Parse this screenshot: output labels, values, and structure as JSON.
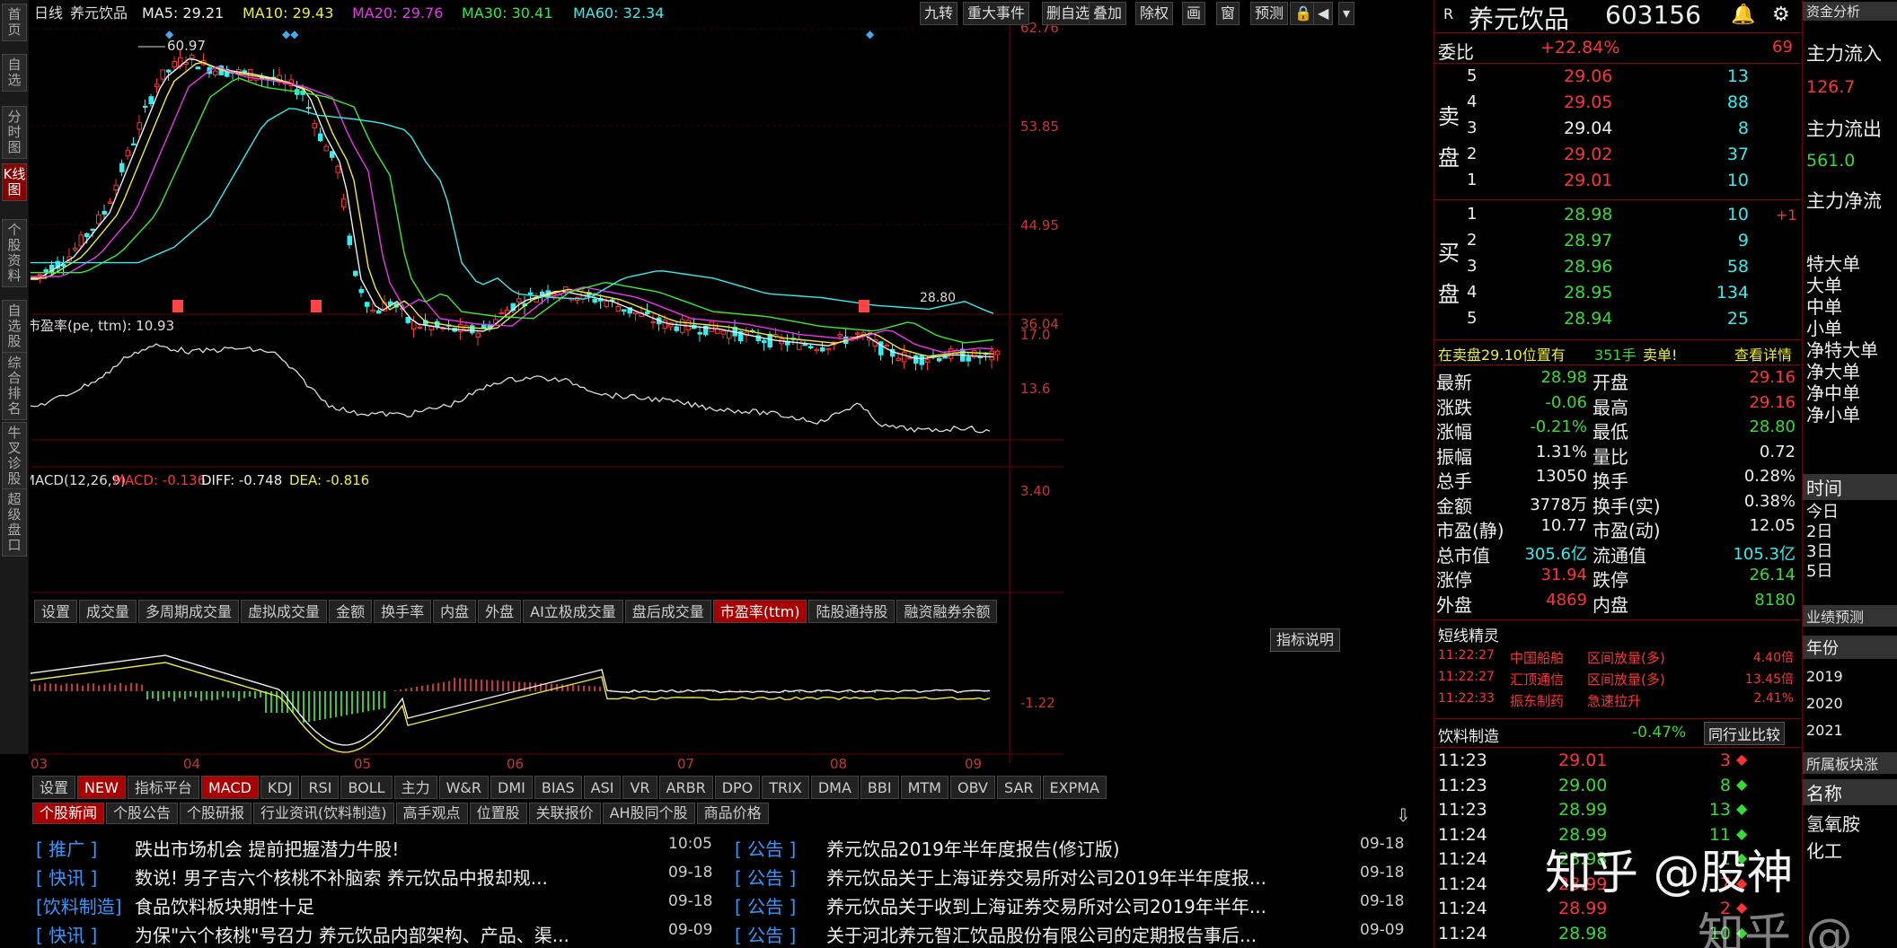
{
  "left_tabs": [
    "首页",
    "自选",
    "分时图",
    "K线图",
    "个股资料",
    "自选股",
    "综合排名",
    "牛叉诊股",
    "超级盘口"
  ],
  "chart_header": {
    "period": "日线",
    "stock": "养元饮品",
    "ma5": "MA5: 29.21",
    "ma10": "MA10: 29.43",
    "ma20": "MA20: 29.76",
    "ma30": "MA30: 30.41",
    "ma60": "MA60: 32.34"
  },
  "toolbar": [
    "九转",
    "重大事件",
    "删自选",
    "叠加",
    "除权",
    "画",
    "窗",
    "预测"
  ],
  "price_axis": [
    "62.76",
    "53.85",
    "44.95",
    "36.04"
  ],
  "high_label": "60.97",
  "low_label": "28.80",
  "pe_header": "市盈率(pe, ttm): 10.93",
  "pe_axis": [
    "17.0",
    "13.6"
  ],
  "indicator_tabs1": [
    "设置",
    "成交量",
    "多周期成交量",
    "虚拟成交量",
    "金额",
    "换手率",
    "内盘",
    "外盘",
    "AI立极成交量",
    "盘后成交量",
    "市盈率(ttm)",
    "陆股通持股",
    "融资融券余额"
  ],
  "indicator_tabs1_active": 10,
  "macd_header": {
    "name": "MACD(12,26,9)",
    "macd": "MACD: -0.136",
    "diff": "DIFF: -0.748",
    "dea": "DEA: -0.816"
  },
  "macd_button": "指标说明",
  "macd_axis": [
    "3.40",
    "-1.22"
  ],
  "months": [
    "03",
    "04",
    "05",
    "06",
    "07",
    "08",
    "09"
  ],
  "indicator_tabs2": [
    "设置",
    "NEW",
    "指标平台",
    "MACD",
    "KDJ",
    "RSI",
    "BOLL",
    "主力",
    "W&R",
    "DMI",
    "BIAS",
    "ASI",
    "VR",
    "ARBR",
    "DPO",
    "TRIX",
    "DMA",
    "BBI",
    "MTM",
    "OBV",
    "SAR",
    "EXPMA"
  ],
  "indicator_tabs2_active": 3,
  "news_tabs": [
    "个股新闻",
    "个股公告",
    "个股研报",
    "行业资讯(饮料制造)",
    "高手观点",
    "位置股",
    "关联报价",
    "AH股同个股",
    "商品价格"
  ],
  "news_left": [
    {
      "tag": "[ 推广 ]",
      "title": "跌出市场机会 提前把握潜力牛股!",
      "time": "10:05"
    },
    {
      "tag": "[ 快讯 ]",
      "title": "数说! 男子吉六个核桃不补脑索 养元饮品中报却规...",
      "time": "09-18"
    },
    {
      "tag": "[饮料制造]",
      "title": "食品饮料板块期性十足",
      "time": "09-18"
    },
    {
      "tag": "[ 快讯 ]",
      "title": "为保\"六个核桃\"号召力 养元饮品内部架构、产品、渠...",
      "time": "09-09"
    }
  ],
  "news_right": [
    {
      "tag": "[ 公告 ]",
      "title": "养元饮品2019年半年度报告(修订版)",
      "time": "09-18"
    },
    {
      "tag": "[ 公告 ]",
      "title": "养元饮品关于上海证券交易所对公司2019年半年度报...",
      "time": "09-18"
    },
    {
      "tag": "[ 公告 ]",
      "title": "养元饮品关于收到上海证券交易所对公司2019年半年...",
      "time": "09-18"
    },
    {
      "tag": "[ 公告 ]",
      "title": "关于河北养元智汇饮品股份有限公司的定期报告事后...",
      "time": "09-09"
    }
  ],
  "quote": {
    "name": "养元饮品",
    "code": "603156",
    "weibi_label": "委比",
    "weibi": "+22.84%",
    "weibi_right": "69",
    "sell_label": [
      "卖",
      "盘"
    ],
    "buy_label": [
      "买",
      "盘"
    ],
    "sell": [
      {
        "n": "5",
        "p": "29.06",
        "v": "13"
      },
      {
        "n": "4",
        "p": "29.05",
        "v": "88"
      },
      {
        "n": "3",
        "p": "29.04",
        "v": "8"
      },
      {
        "n": "2",
        "p": "29.02",
        "v": "37"
      },
      {
        "n": "1",
        "p": "29.01",
        "v": "10"
      }
    ],
    "buy": [
      {
        "n": "1",
        "p": "28.98",
        "v": "10"
      },
      {
        "n": "2",
        "p": "28.97",
        "v": "9"
      },
      {
        "n": "3",
        "p": "28.96",
        "v": "58"
      },
      {
        "n": "4",
        "p": "28.95",
        "v": "134"
      },
      {
        "n": "5",
        "p": "28.94",
        "v": "25"
      }
    ],
    "buy1_right": "+1",
    "pending_info": "在卖盘29.10位置有",
    "pending_vol": "351手",
    "pending_btn": "卖单!",
    "pending_detail": "查看详情",
    "stats": [
      {
        "l1": "最新",
        "v1": "28.98",
        "c1": "green",
        "l2": "开盘",
        "v2": "29.16",
        "c2": "red"
      },
      {
        "l1": "涨跌",
        "v1": "-0.06",
        "c1": "green",
        "l2": "最高",
        "v2": "29.16",
        "c2": "red"
      },
      {
        "l1": "涨幅",
        "v1": "-0.21%",
        "c1": "green",
        "l2": "最低",
        "v2": "28.80",
        "c2": "green"
      },
      {
        "l1": "振幅",
        "v1": "1.31%",
        "c1": "white",
        "l2": "量比",
        "v2": "0.72",
        "c2": "white"
      },
      {
        "l1": "总手",
        "v1": "13050",
        "c1": "white",
        "l2": "换手",
        "v2": "0.28%",
        "c2": "white"
      },
      {
        "l1": "金额",
        "v1": "3778万",
        "c1": "white",
        "l2": "换手(实)",
        "v2": "0.38%",
        "c2": "white"
      },
      {
        "l1": "市盈(静)",
        "v1": "10.77",
        "c1": "white",
        "l2": "市盈(动)",
        "v2": "12.05",
        "c2": "white"
      },
      {
        "l1": "总市值",
        "v1": "305.6亿",
        "c1": "cyan",
        "l2": "流通值",
        "v2": "105.3亿",
        "c2": "cyan"
      },
      {
        "l1": "涨停",
        "v1": "31.94",
        "c1": "red",
        "l2": "跌停",
        "v2": "26.14",
        "c2": "green"
      },
      {
        "l1": "外盘",
        "v1": "4869",
        "c1": "red",
        "l2": "内盘",
        "v2": "8180",
        "c2": "green"
      }
    ],
    "elves_title": "短线精灵",
    "elves": [
      {
        "t": "11:22:27",
        "s": "中国船舶",
        "e": "区间放量(多)",
        "v": "4.40倍"
      },
      {
        "t": "11:22:27",
        "s": "汇顶通信",
        "e": "区间放量(多)",
        "v": "13.45倍"
      },
      {
        "t": "11:22:33",
        "s": "振东制药",
        "e": "急速拉升",
        "v": "2.41%"
      }
    ],
    "industry": "饮料制造",
    "industry_pct": "-0.47%",
    "industry_btn": "同行业比较",
    "ticks": [
      {
        "t": "11:23",
        "p": "29.01",
        "v": "3",
        "d": "up"
      },
      {
        "t": "11:23",
        "p": "29.00",
        "v": "8",
        "d": "down"
      },
      {
        "t": "11:23",
        "p": "28.99",
        "v": "13",
        "d": "down"
      },
      {
        "t": "11:24",
        "p": "28.99",
        "v": "11",
        "d": "down"
      },
      {
        "t": "11:24",
        "p": "28.98",
        "v": "1",
        "d": "down"
      },
      {
        "t": "11:24",
        "p": "28.99",
        "v": "7",
        "d": "up"
      },
      {
        "t": "11:24",
        "p": "28.99",
        "v": "2",
        "d": "up"
      },
      {
        "t": "11:24",
        "p": "28.98",
        "v": "10",
        "d": "down"
      }
    ]
  },
  "far_right": {
    "title": "资金分析",
    "l1": "主力流入",
    "v1": "126.7",
    "l2": "主力流出",
    "v2": "561.0",
    "l3": "主力净流",
    "list": [
      "特大单",
      "大单",
      "中单",
      "小单",
      "净特大单",
      "净大单",
      "净中单",
      "净小单"
    ],
    "time_label": "时间",
    "days": [
      "今日",
      "2日",
      "3日",
      "5日"
    ],
    "perf": "业绩预测",
    "year": "年份",
    "years": [
      "2019",
      "2020",
      "2021"
    ],
    "sector": "所属板块涨",
    "name": "名称",
    "sectors": [
      "氢氧胺",
      "化工"
    ]
  },
  "watermark": "知乎 @股神",
  "watermark2": "知乎 @"
}
